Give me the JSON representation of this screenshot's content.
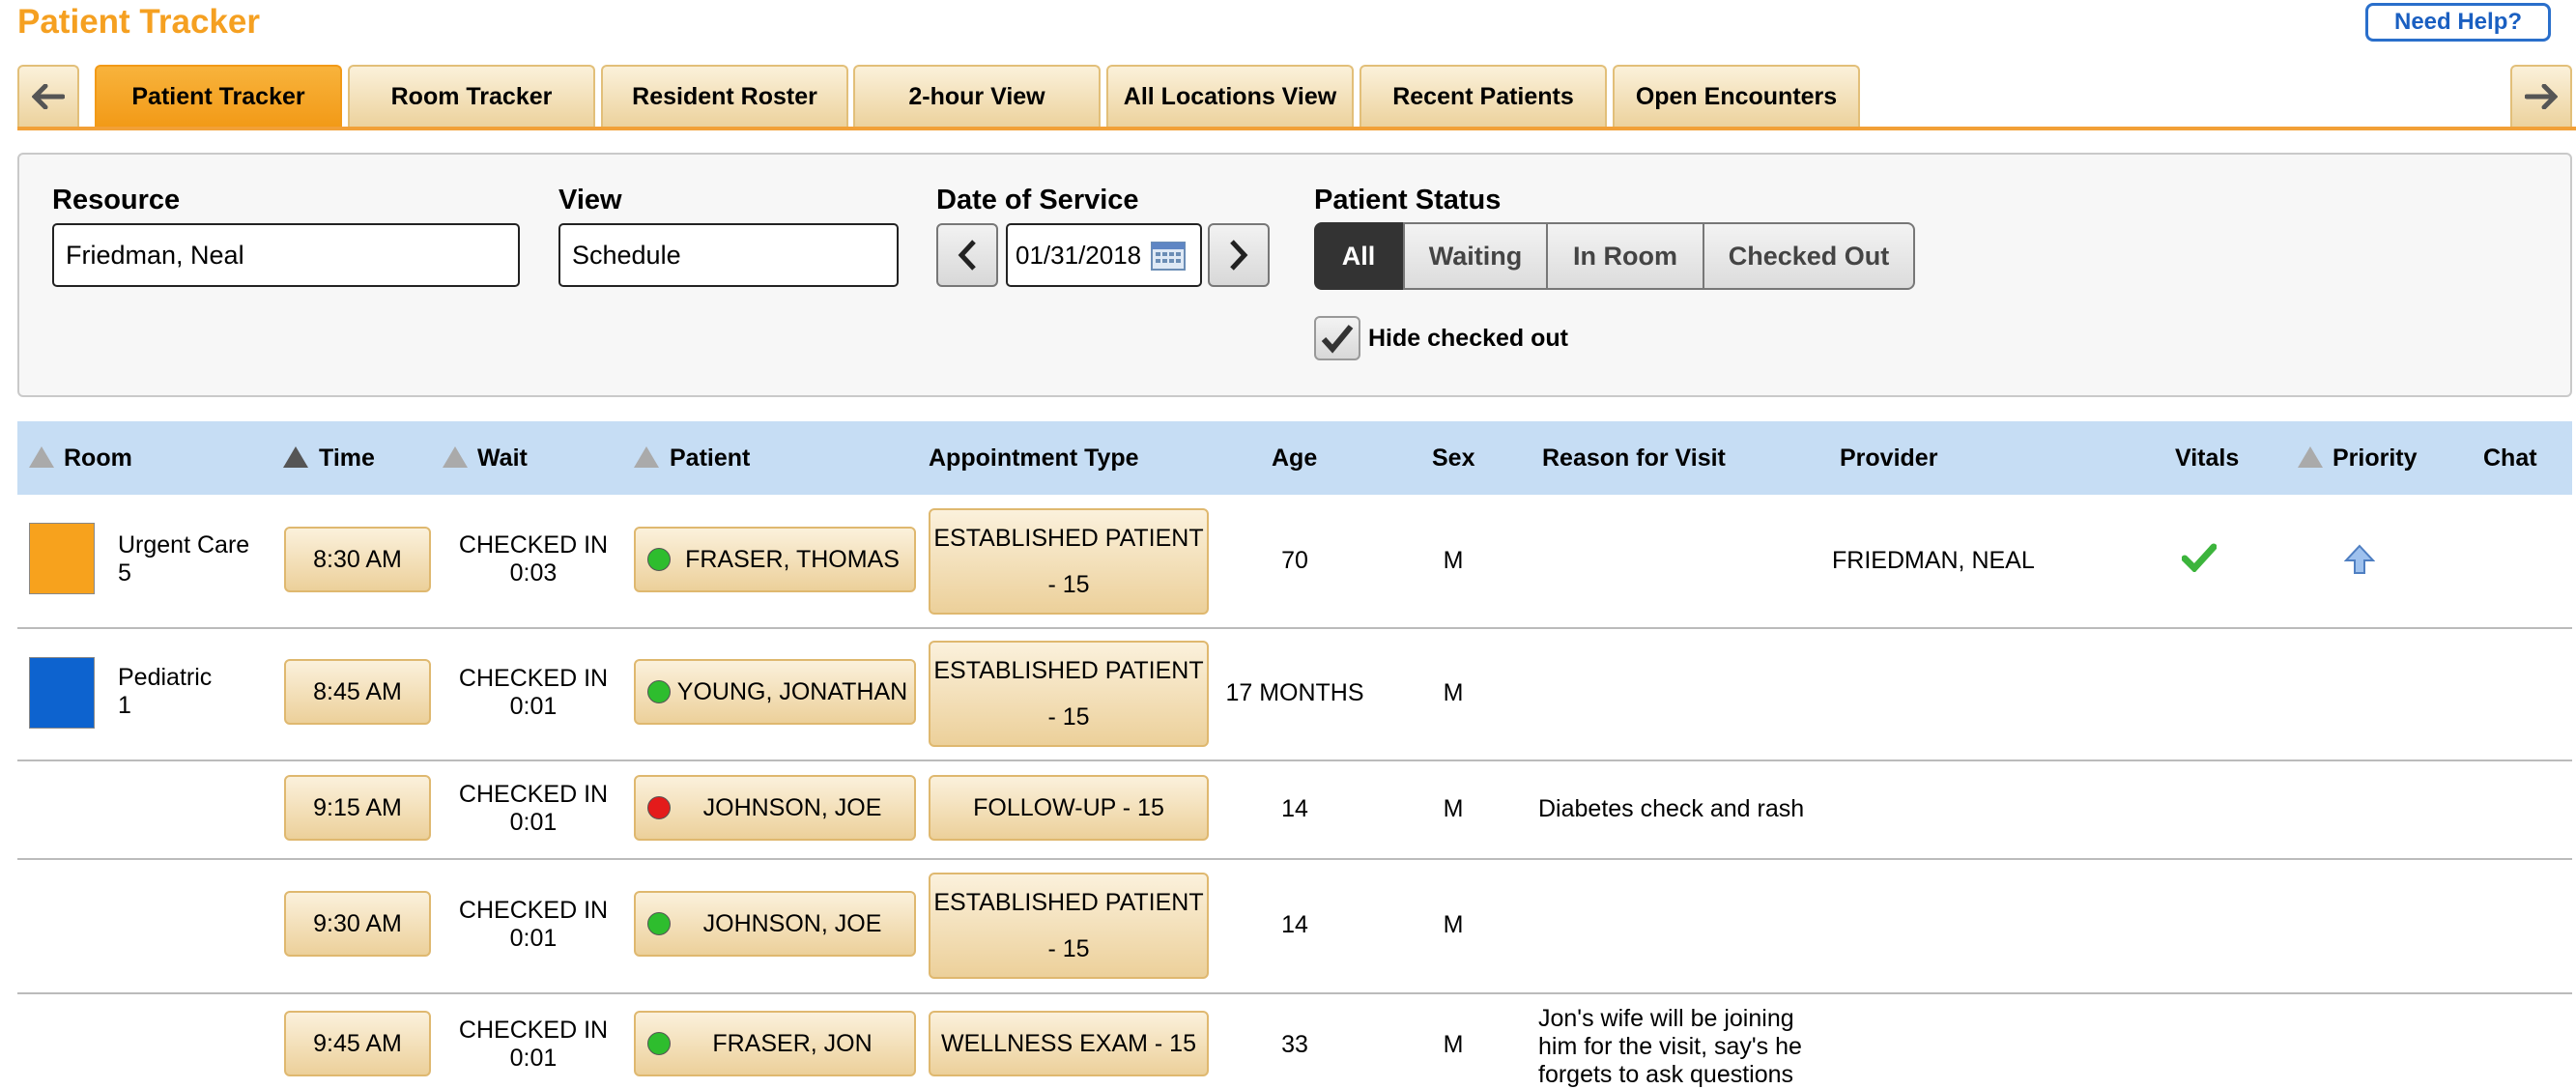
{
  "header": {
    "title": "Patient Tracker",
    "help_label": "Need Help?"
  },
  "tabs": [
    {
      "label": "Patient Tracker",
      "active": true
    },
    {
      "label": "Room Tracker",
      "active": false
    },
    {
      "label": "Resident Roster",
      "active": false
    },
    {
      "label": "2-hour View",
      "active": false
    },
    {
      "label": "All Locations View",
      "active": false
    },
    {
      "label": "Recent Patients",
      "active": false
    },
    {
      "label": "Open Encounters",
      "active": false
    }
  ],
  "filters": {
    "resource_label": "Resource",
    "resource_value": "Friedman, Neal",
    "view_label": "View",
    "view_value": "Schedule",
    "date_label": "Date of Service",
    "date_value": "01/31/2018",
    "status_label": "Patient Status",
    "status_options": [
      "All",
      "Waiting",
      "In Room",
      "Checked Out"
    ],
    "status_selected": "All",
    "hide_checked_out_label": "Hide checked out",
    "hide_checked_out": true
  },
  "table": {
    "columns": [
      "Room",
      "Time",
      "Wait",
      "Patient",
      "Appointment Type",
      "Age",
      "Sex",
      "Reason for Visit",
      "Provider",
      "Vitals",
      "Priority",
      "Chat"
    ],
    "rows": [
      {
        "room_color": "#f7a21d",
        "room": "Urgent Care 5",
        "room_line1": "Urgent Care",
        "room_line2": "5",
        "time": "8:30 AM",
        "wait_status": "CHECKED IN",
        "wait_time": "0:03",
        "status_color": "#2ebd2e",
        "patient": "FRASER, THOMAS",
        "appt_line1": "ESTABLISHED PATIENT",
        "appt_line2": "- 15",
        "age": "70",
        "sex": "M",
        "reason": "",
        "provider": "FRIEDMAN, NEAL",
        "vitals_icon": "check-icon",
        "priority_icon": "up-arrow-icon"
      },
      {
        "room_color": "#0d63cf",
        "room": "Pediatric 1",
        "room_line1": "Pediatric",
        "room_line2": "1",
        "time": "8:45 AM",
        "wait_status": "CHECKED IN",
        "wait_time": "0:01",
        "status_color": "#2ebd2e",
        "patient": "YOUNG, JONATHAN",
        "appt_line1": "ESTABLISHED PATIENT",
        "appt_line2": "- 15",
        "age": "17 MONTHS",
        "sex": "M",
        "reason": "",
        "provider": ""
      },
      {
        "time": "9:15 AM",
        "wait_status": "CHECKED IN",
        "wait_time": "0:01",
        "status_color": "#e41b1b",
        "patient": "JOHNSON, JOE",
        "appt_line1": "FOLLOW-UP - 15",
        "appt_line2": "",
        "age": "14",
        "sex": "M",
        "reason": "Diabetes check and rash",
        "provider": ""
      },
      {
        "time": "9:30 AM",
        "wait_status": "CHECKED IN",
        "wait_time": "0:01",
        "status_color": "#2ebd2e",
        "patient": "JOHNSON, JOE",
        "appt_line1": "ESTABLISHED PATIENT",
        "appt_line2": "- 15",
        "age": "14",
        "sex": "M",
        "reason": "",
        "provider": ""
      },
      {
        "time": "9:45 AM",
        "wait_status": "CHECKED IN",
        "wait_time": "0:01",
        "status_color": "#2ebd2e",
        "patient": "FRASER, JON",
        "appt_line1": "WELLNESS EXAM - 15",
        "appt_line2": "",
        "age": "33",
        "sex": "M",
        "reason_line1": "Jon's wife will be joining",
        "reason_line2": "him for the visit, say's he",
        "reason_line3": "forgets to ask questions",
        "provider": ""
      }
    ]
  }
}
